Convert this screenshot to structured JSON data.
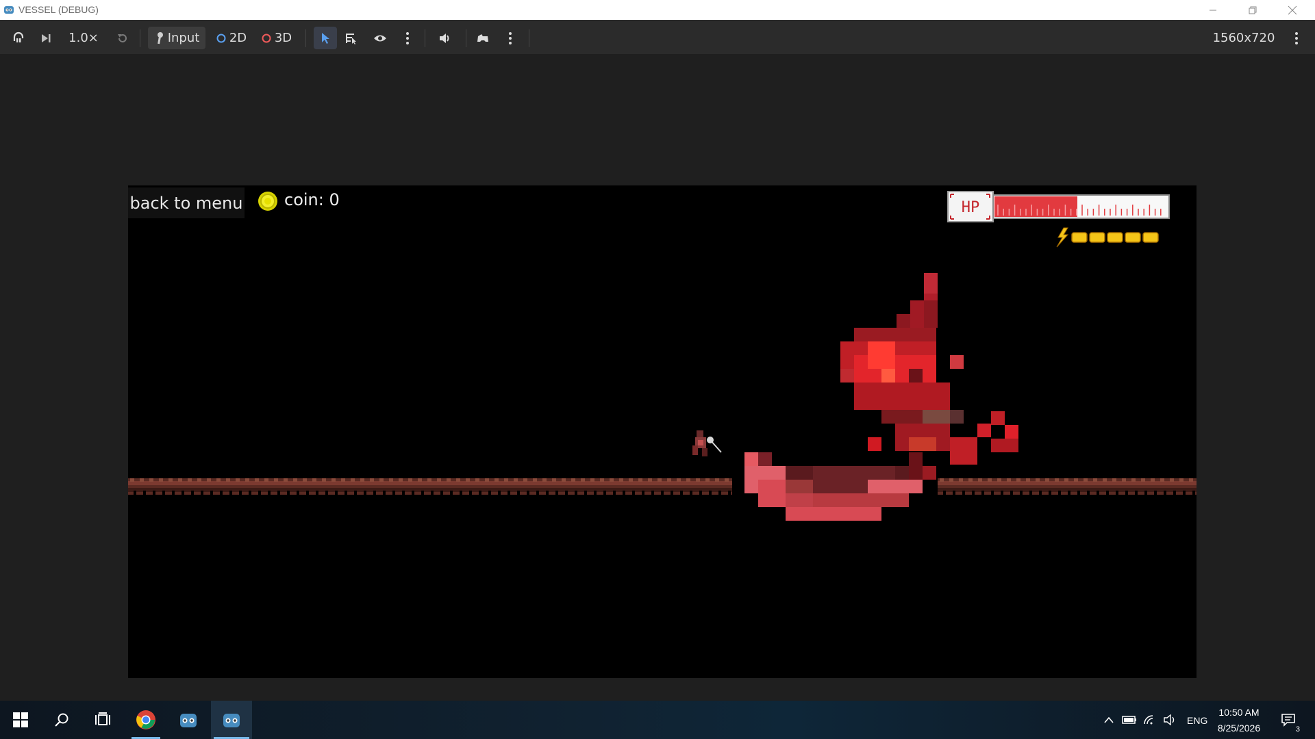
{
  "window": {
    "title": "VESSEL (DEBUG)"
  },
  "toolbar": {
    "speed": "1.0×",
    "input_label": "Input",
    "mode_2d": "2D",
    "mode_3d": "3D",
    "resolution": "1560x720"
  },
  "game": {
    "back_button": "back to menu",
    "coin_label": "coin: 0",
    "hp_label": "HP",
    "hp_fraction": 0.48,
    "energy_segments": 5
  },
  "taskbar": {
    "language": "ENG",
    "time": "10:50 AM",
    "date": "8/25/2026",
    "notifications": "3"
  },
  "colors": {
    "hp_red": "#e23a3f",
    "energy_yellow": "#f5c518",
    "accent_blue": "#5aa0f0"
  }
}
